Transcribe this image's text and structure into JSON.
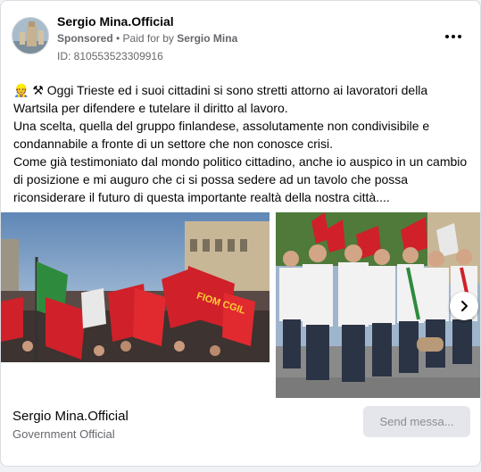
{
  "post": {
    "page_name": "Sergio Mina.Official",
    "sponsored": "Sponsored",
    "separator": " • ",
    "paid_for_by_prefix": "Paid for by ",
    "paid_for_by_name": "Sergio Mina",
    "ad_id": "ID: 810553523309916",
    "text_lines": [
      "👷 ⚒ Oggi Trieste ed i suoi cittadini si sono stretti attorno ai lavoratori della Wartsila per difendere e tutelare il diritto al lavoro.",
      "Una scelta, quella del gruppo finlandese, assolutamente non condivisibile e condannabile a fronte di un settore che non conosce crisi.",
      "Come già testimoniato dal mondo politico cittadino, anche io auspico in un cambio di posizione e mi auguro che ci si possa sedere ad un tavolo che possa riconsiderare il futuro di questa importante realtà della nostra città...."
    ]
  },
  "media": {
    "left_photo_banner_text": "FIOM CGIL",
    "left_photo_alt": "crowd-with-red-union-flags",
    "right_photo_alt": "officials-marching-with-banners"
  },
  "footer": {
    "page_name": "Sergio Mina.Official",
    "category": "Government Official",
    "send_button_label": "Send messa..."
  },
  "colors": {
    "accent_gray": "#65676b",
    "flag_red": "#d0202a",
    "button_bg": "#e4e6eb"
  },
  "icons": {
    "more": "three-dots-icon",
    "next": "chevron-right-icon"
  }
}
